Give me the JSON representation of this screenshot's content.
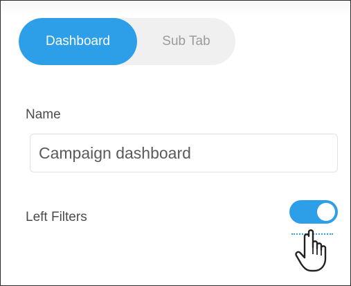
{
  "tabs": [
    {
      "label": "Dashboard",
      "active": true
    },
    {
      "label": "Sub Tab",
      "active": false
    }
  ],
  "name_field": {
    "label": "Name",
    "value": "Campaign dashboard"
  },
  "left_filters": {
    "label": "Left Filters",
    "enabled": true
  },
  "cursor": {
    "icon": "hand-pointer-icon"
  },
  "colors": {
    "accent": "#2d9ee8",
    "tab_inactive_bg": "#f0f0f0",
    "text": "#4a4a4a"
  }
}
